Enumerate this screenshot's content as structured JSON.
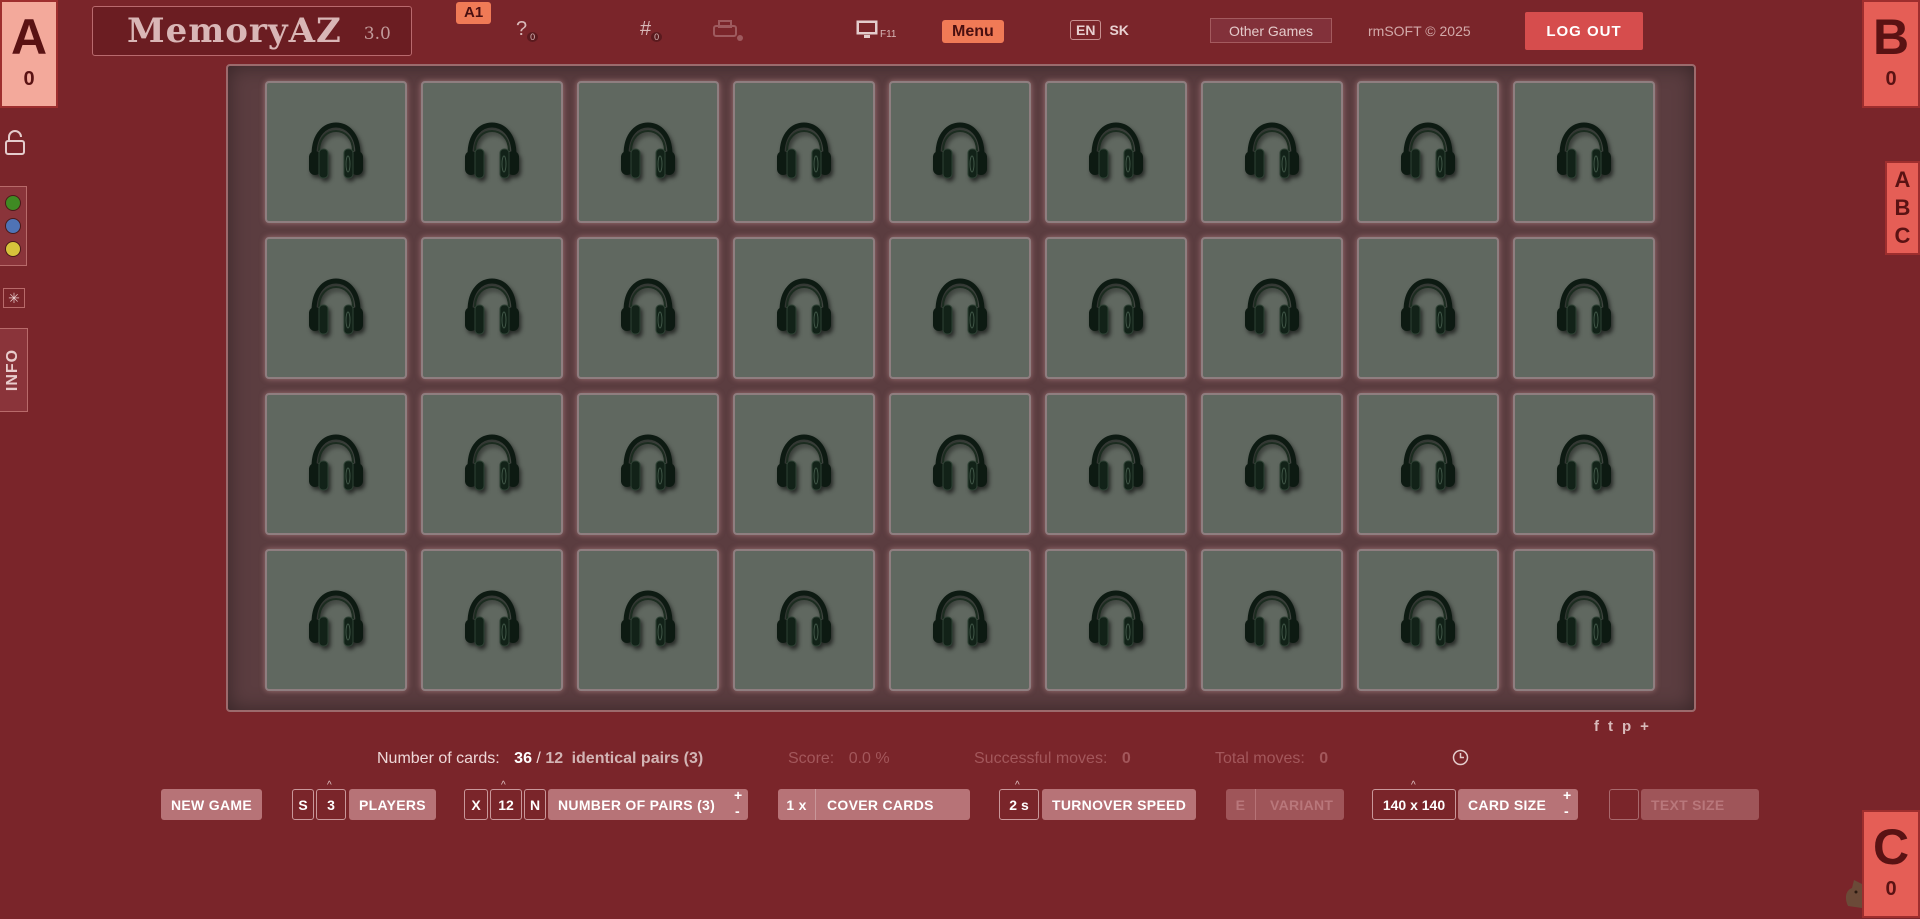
{
  "header": {
    "logo": "MemoryAZ",
    "version": "3.0",
    "level_badge": "A1",
    "help_icon": "?",
    "help_sub": "0",
    "grid_icon": "#",
    "grid_sub": "0",
    "fullscreen_key": "F11",
    "menu_label": "Menu",
    "lang_en": "EN",
    "lang_sk": "SK",
    "other_games": "Other Games",
    "copyright": "rmSOFT © 2025",
    "logout": "LOG OUT"
  },
  "players": {
    "a": {
      "letter": "A",
      "score": "0"
    },
    "b": {
      "letter": "B",
      "score": "0"
    },
    "c": {
      "letter": "C",
      "score": "0"
    }
  },
  "abc_tab": [
    "A",
    "B",
    "C"
  ],
  "side": {
    "colors": [
      "#3f8a23",
      "#4f73b5",
      "#d6c33b"
    ],
    "star": "✳",
    "info": "INFO"
  },
  "board": {
    "rows": 4,
    "cols": 9,
    "card_icon": "headphones-icon"
  },
  "social": [
    "f",
    "t",
    "p",
    "+"
  ],
  "stats": {
    "cards_label": "Number of cards:",
    "cards_value": "36",
    "slash": "/",
    "pairs_value": "12",
    "pairs_label": "identical pairs (3)",
    "score_label": "Score:",
    "score_value": "0.0 %",
    "successful_label": "Successful moves:",
    "successful_value": "0",
    "total_label": "Total moves:",
    "total_value": "0"
  },
  "controls": {
    "new_game": "NEW GAME",
    "players_s": "S",
    "players_count": "3",
    "players_label": "PLAYERS",
    "pairs_x": "X",
    "pairs_count": "12",
    "pairs_n": "N",
    "pairs_label": "NUMBER OF PAIRS (3)",
    "cover_count": "1 x",
    "cover_label": "COVER CARDS",
    "turnover_value": "2 s",
    "turnover_label": "TURNOVER SPEED",
    "variant_e": "E",
    "variant_label": "VARIANT",
    "card_size_value": "140 x 140",
    "card_size_label": "CARD SIZE",
    "text_size_label": "TEXT SIZE",
    "plus": "+",
    "minus": "-"
  }
}
